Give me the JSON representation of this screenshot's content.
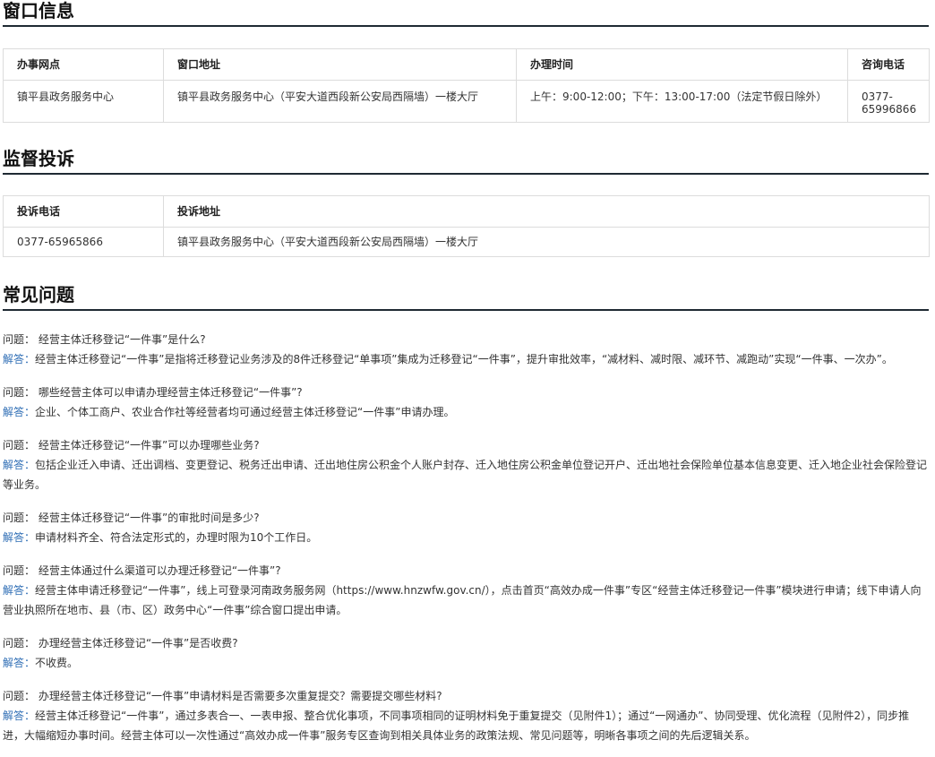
{
  "window_section": {
    "title": "窗口信息",
    "headers": [
      "办事网点",
      "窗口地址",
      "办理时间",
      "咨询电话"
    ],
    "row": [
      "镇平县政务服务中心",
      "镇平县政务服务中心（平安大道西段新公安局西隔墙）一楼大厅",
      "上午：9:00-12:00；下午：13:00-17:00（法定节假日除外）",
      "0377-65996866"
    ]
  },
  "complaint_section": {
    "title": "监督投诉",
    "headers": [
      "投诉电话",
      "投诉地址"
    ],
    "row": [
      "0377-65965866",
      "镇平县政务服务中心（平安大道西段新公安局西隔墙）一楼大厅"
    ]
  },
  "faq_section": {
    "title": "常见问题",
    "question_label": "问题：",
    "answer_label": "解答：",
    "items": [
      {
        "q": "经营主体迁移登记“一件事”是什么?",
        "a": "经营主体迁移登记“一件事”是指将迁移登记业务涉及的8件迁移登记“单事项”集成为迁移登记“一件事”，提升审批效率，“减材料、减时限、减环节、减跑动”实现“一件事、一次办”。"
      },
      {
        "q": "哪些经营主体可以申请办理经营主体迁移登记“一件事”?",
        "a": "企业、个体工商户、农业合作社等经营者均可通过经营主体迁移登记“一件事”申请办理。"
      },
      {
        "q": "经营主体迁移登记“一件事”可以办理哪些业务?",
        "a": "包括企业迁入申请、迁出调档、变更登记、税务迁出申请、迁出地住房公积金个人账户封存、迁入地住房公积金单位登记开户、迁出地社会保险单位基本信息变更、迁入地企业社会保险登记等业务。"
      },
      {
        "q": "经营主体迁移登记“一件事”的审批时间是多少?",
        "a": "申请材料齐全、符合法定形式的，办理时限为10个工作日。"
      },
      {
        "q": "经营主体通过什么渠道可以办理迁移登记“一件事”?",
        "a": "经营主体申请迁移登记“一件事”，线上可登录河南政务服务网（https://www.hnzwfw.gov.cn/），点击首页“高效办成一件事”专区“经营主体迁移登记一件事”模块进行申请；线下申请人向营业执照所在地市、县（市、区）政务中心“一件事”综合窗口提出申请。"
      },
      {
        "q": "办理经营主体迁移登记“一件事”是否收费?",
        "a": "不收费。"
      },
      {
        "q": "办理经营主体迁移登记“一件事”申请材料是否需要多次重复提交？需要提交哪些材料?",
        "a": "经营主体迁移登记“一件事”，通过多表合一、一表申报、整合优化事项，不同事项相同的证明材料免于重复提交（见附件1）；通过“一网通办”、协同受理、优化流程（见附件2），同步推进，大幅缩短办事时间。经营主体可以一次性通过“高效办成一件事”服务专区查询到相关具体业务的政策法规、常见问题等，明晰各事项之间的先后逻辑关系。"
      }
    ]
  }
}
